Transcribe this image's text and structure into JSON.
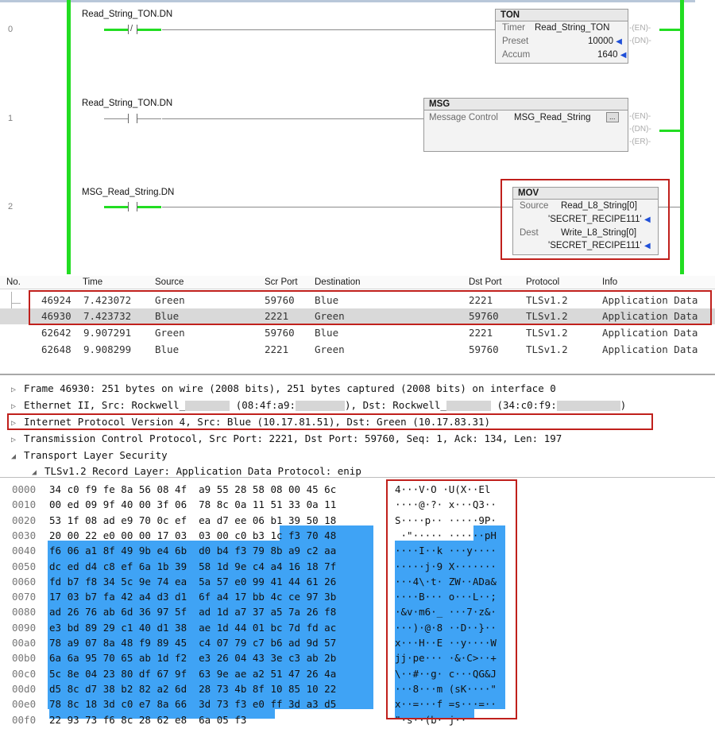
{
  "ladder": {
    "rungs": [
      {
        "number": "0",
        "contact_tag": "Read_String_TON.DN"
      },
      {
        "number": "1",
        "contact_tag": "Read_String_TON.DN"
      },
      {
        "number": "2",
        "contact_tag": "MSG_Read_String.DN"
      }
    ],
    "ton": {
      "title": "TON",
      "timer_label": "Timer",
      "timer_value": "Read_String_TON",
      "preset_label": "Preset",
      "preset_value": "10000",
      "accum_label": "Accum",
      "accum_value": "1640",
      "outputs": [
        "EN",
        "DN"
      ]
    },
    "msg": {
      "title": "MSG",
      "control_label": "Message Control",
      "control_value": "MSG_Read_String",
      "ellipsis": "...",
      "outputs": [
        "EN",
        "DN",
        "ER"
      ]
    },
    "mov": {
      "title": "MOV",
      "source_label": "Source",
      "source_value": "Read_L8_String[0]",
      "source_data": "'SECRET_RECIPE111'",
      "dest_label": "Dest",
      "dest_value": "Write_L8_String[0]",
      "dest_data": "'SECRET_RECIPE111'"
    }
  },
  "packet_list": {
    "columns": [
      "No.",
      "Time",
      "Source",
      "Scr Port",
      "Destination",
      "Dst Port",
      "Protocol",
      "Info"
    ],
    "rows": [
      {
        "no": "46924",
        "time": "7.423072",
        "source": "Green",
        "src_port": "59760",
        "destination": "Blue",
        "dst_port": "2221",
        "protocol": "TLSv1.2",
        "info": "Application Data"
      },
      {
        "no": "46930",
        "time": "7.423732",
        "source": "Blue",
        "src_port": "2221",
        "destination": "Green",
        "dst_port": "59760",
        "protocol": "TLSv1.2",
        "info": "Application Data"
      },
      {
        "no": "62642",
        "time": "9.907291",
        "source": "Green",
        "src_port": "59760",
        "destination": "Blue",
        "dst_port": "2221",
        "protocol": "TLSv1.2",
        "info": "Application Data"
      },
      {
        "no": "62648",
        "time": "9.908299",
        "source": "Blue",
        "src_port": "2221",
        "destination": "Green",
        "dst_port": "59760",
        "protocol": "TLSv1.2",
        "info": "Application Data"
      }
    ]
  },
  "details": {
    "frame": "Frame 46930: 251 bytes on wire (2008 bits), 251 bytes captured (2008 bits) on interface 0",
    "eth_a": "Ethernet II, Src: Rockwell_",
    "eth_b": "(08:4f:a9:",
    "eth_c": "), Dst: Rockwell_",
    "eth_d": "(34:c0:f9:",
    "eth_e": ")",
    "ip_a": "Internet Protocol Version 4, Src: Blue",
    "ip_b": "(10.17.81.51), Dst: Green",
    "ip_c": "(10.17.83.31)",
    "tcp": "Transmission Control Protocol, Src Port: 2221, Dst Port: 59760, Seq: 1, Ack: 134, Len: 197",
    "tls": "Transport Layer Security",
    "tls_record": "TLSv1.2 Record Layer: Application Data Protocol: enip"
  },
  "hex": {
    "rows": [
      {
        "offset": "0000",
        "bytes": "34 c0 f9 fe 8a 56 08 4f  a9 55 28 58 08 00 45 6c",
        "ascii": "4···V·O ·U(X··El"
      },
      {
        "offset": "0010",
        "bytes": "00 ed 09 9f 40 00 3f 06  78 8c 0a 11 51 33 0a 11",
        "ascii": "····@·?· x···Q3··"
      },
      {
        "offset": "0020",
        "bytes": "53 1f 08 ad e9 70 0c ef  ea d7 ee 06 b1 39 50 18",
        "ascii": "S····p·· ·····9P·"
      },
      {
        "offset": "0030",
        "bytes": "20 00 22 e0 00 00 17 03  03 00 c0 b3 1c f3 70 48",
        "ascii": " ·\"····· ······pH"
      },
      {
        "offset": "0040",
        "bytes": "f6 06 a1 8f 49 9b e4 6b  d0 b4 f3 79 8b a9 c2 aa",
        "ascii": "····I··k ···y····"
      },
      {
        "offset": "0050",
        "bytes": "dc ed d4 c8 ef 6a 1b 39  58 1d 9e c4 a4 16 18 7f",
        "ascii": "·····j·9 X·······"
      },
      {
        "offset": "0060",
        "bytes": "fd b7 f8 34 5c 9e 74 ea  5a 57 e0 99 41 44 61 26",
        "ascii": "···4\\·t· ZW··ADa&"
      },
      {
        "offset": "0070",
        "bytes": "17 03 b7 fa 42 a4 d3 d1  6f a4 17 bb 4c ce 97 3b",
        "ascii": "····B··· o···L··;"
      },
      {
        "offset": "0080",
        "bytes": "ad 26 76 ab 6d 36 97 5f  ad 1d a7 37 a5 7a 26 f8",
        "ascii": "·&v·m6·_ ···7·z&·"
      },
      {
        "offset": "0090",
        "bytes": "e3 bd 89 29 c1 40 d1 38  ae 1d 44 01 bc 7d fd ac",
        "ascii": "···)·@·8 ··D··}··"
      },
      {
        "offset": "00a0",
        "bytes": "78 a9 07 8a 48 f9 89 45  c4 07 79 c7 b6 ad 9d 57",
        "ascii": "x···H··E ··y····W"
      },
      {
        "offset": "00b0",
        "bytes": "6a 6a 95 70 65 ab 1d f2  e3 26 04 43 3e c3 ab 2b",
        "ascii": "jj·pe··· ·&·C>··+"
      },
      {
        "offset": "00c0",
        "bytes": "5c 8e 04 23 80 df 67 9f  63 9e ae a2 51 47 26 4a",
        "ascii": "\\··#··g· c···QG&J"
      },
      {
        "offset": "00d0",
        "bytes": "d5 8c d7 38 b2 82 a2 6d  28 73 4b 8f 10 85 10 22",
        "ascii": "···8···m (sK····\""
      },
      {
        "offset": "00e0",
        "bytes": "78 8c 18 3d c0 e7 8a 66  3d 73 f3 e0 ff 3d a3 d5",
        "ascii": "x··=···f =s···=··"
      },
      {
        "offset": "00f0",
        "bytes": "22 93 73 f6 8c 28 62 e8  6a 05 f3",
        "ascii": "\"·s··(b· j··"
      }
    ]
  },
  "colors": {
    "rail": "#22dd22",
    "highlight": "#c0201c",
    "selection": "#3fa3f5"
  }
}
